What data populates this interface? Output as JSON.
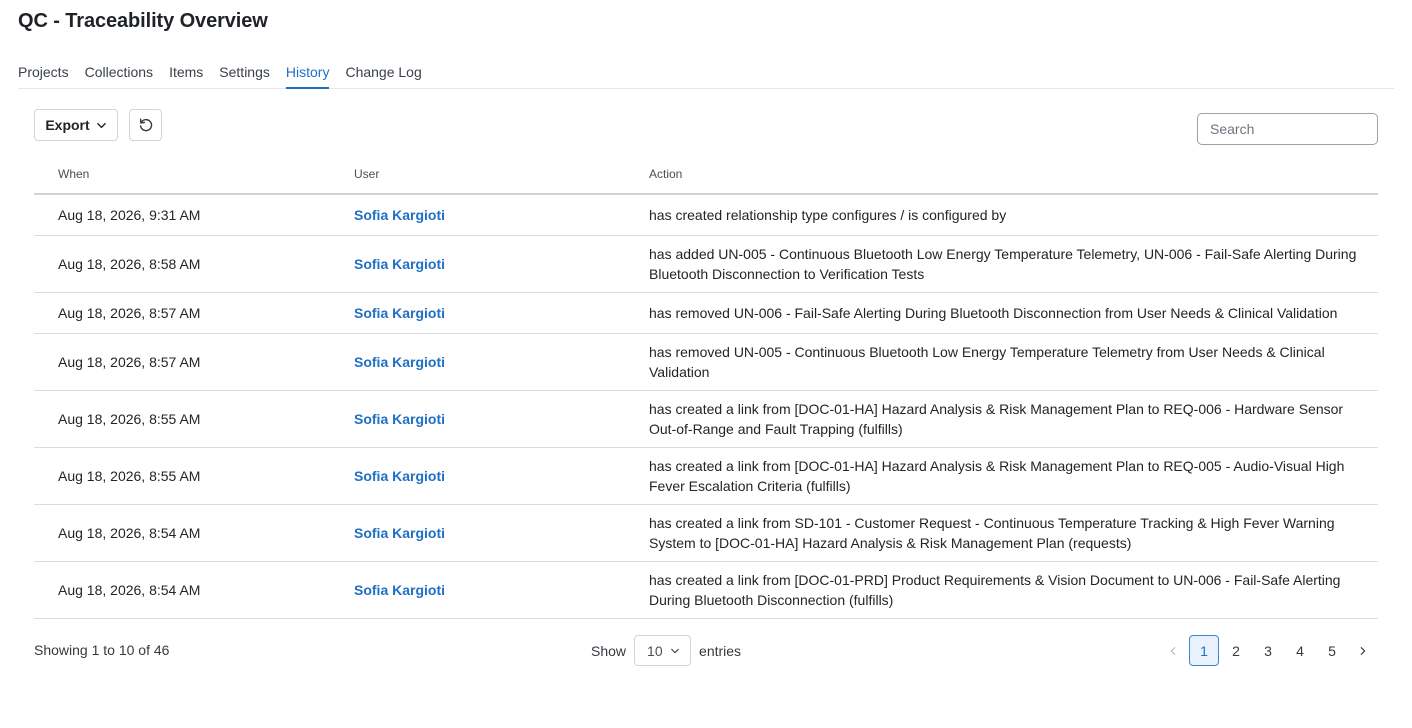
{
  "page": {
    "title": "QC - Traceability Overview"
  },
  "tabs": [
    {
      "label": "Projects"
    },
    {
      "label": "Collections"
    },
    {
      "label": "Items"
    },
    {
      "label": "Settings"
    },
    {
      "label": "History",
      "active": true
    },
    {
      "label": "Change Log"
    }
  ],
  "toolbar": {
    "export_label": "Export",
    "export_icon": "chevron-down-icon",
    "refresh_icon": "refresh-icon",
    "search_placeholder": "Search"
  },
  "table": {
    "columns": {
      "when": "When",
      "user": "User",
      "action": "Action"
    },
    "rows": [
      {
        "when": "Aug 18, 2026, 9:31 AM",
        "user": "Sofia Kargioti",
        "action": "has created relationship type configures / is configured by"
      },
      {
        "when": "Aug 18, 2026, 8:58 AM",
        "user": "Sofia Kargioti",
        "action": "has added UN-005 - Continuous Bluetooth Low Energy Temperature Telemetry, UN-006 - Fail-Safe Alerting During Bluetooth Disconnection to Verification Tests"
      },
      {
        "when": "Aug 18, 2026, 8:57 AM",
        "user": "Sofia Kargioti",
        "action": "has removed UN-006 - Fail-Safe Alerting During Bluetooth Disconnection from User Needs & Clinical Validation"
      },
      {
        "when": "Aug 18, 2026, 8:57 AM",
        "user": "Sofia Kargioti",
        "action": "has removed UN-005 - Continuous Bluetooth Low Energy Temperature Telemetry from User Needs & Clinical Validation"
      },
      {
        "when": "Aug 18, 2026, 8:55 AM",
        "user": "Sofia Kargioti",
        "action": "has created a link from [DOC-01-HA] Hazard Analysis & Risk Management Plan to REQ-006 - Hardware Sensor Out-of-Range and Fault Trapping (fulfills)"
      },
      {
        "when": "Aug 18, 2026, 8:55 AM",
        "user": "Sofia Kargioti",
        "action": "has created a link from [DOC-01-HA] Hazard Analysis & Risk Management Plan to REQ-005 - Audio-Visual High Fever Escalation Criteria (fulfills)"
      },
      {
        "when": "Aug 18, 2026, 8:54 AM",
        "user": "Sofia Kargioti",
        "action": "has created a link from SD-101 - Customer Request - Continuous Temperature Tracking & High Fever Warning System to [DOC-01-HA] Hazard Analysis & Risk Management Plan (requests)"
      },
      {
        "when": "Aug 18, 2026, 8:54 AM",
        "user": "Sofia Kargioti",
        "action": "has created a link from [DOC-01-PRD] Product Requirements & Vision Document to UN-006 - Fail-Safe Alerting During Bluetooth Disconnection (fulfills)"
      }
    ]
  },
  "footer": {
    "info": "Showing 1 to 10 of 46",
    "show_label": "Show",
    "page_size": "10",
    "entries_label": "entries",
    "pages": [
      "1",
      "2",
      "3",
      "4",
      "5"
    ],
    "current_page": "1"
  },
  "colors": {
    "accent": "#1f6fc5",
    "border": "#d9dde1"
  }
}
